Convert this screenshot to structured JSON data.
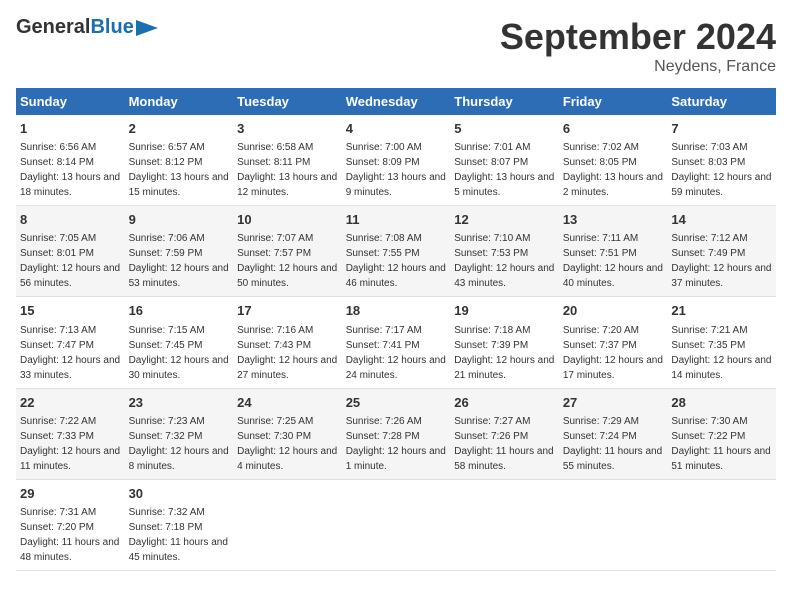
{
  "header": {
    "logo_general": "General",
    "logo_blue": "Blue",
    "month": "September 2024",
    "location": "Neydens, France"
  },
  "weekdays": [
    "Sunday",
    "Monday",
    "Tuesday",
    "Wednesday",
    "Thursday",
    "Friday",
    "Saturday"
  ],
  "weeks": [
    [
      {
        "day": "1",
        "sunrise": "6:56 AM",
        "sunset": "8:14 PM",
        "daylight": "13 hours and 18 minutes."
      },
      {
        "day": "2",
        "sunrise": "6:57 AM",
        "sunset": "8:12 PM",
        "daylight": "13 hours and 15 minutes."
      },
      {
        "day": "3",
        "sunrise": "6:58 AM",
        "sunset": "8:11 PM",
        "daylight": "13 hours and 12 minutes."
      },
      {
        "day": "4",
        "sunrise": "7:00 AM",
        "sunset": "8:09 PM",
        "daylight": "13 hours and 9 minutes."
      },
      {
        "day": "5",
        "sunrise": "7:01 AM",
        "sunset": "8:07 PM",
        "daylight": "13 hours and 5 minutes."
      },
      {
        "day": "6",
        "sunrise": "7:02 AM",
        "sunset": "8:05 PM",
        "daylight": "13 hours and 2 minutes."
      },
      {
        "day": "7",
        "sunrise": "7:03 AM",
        "sunset": "8:03 PM",
        "daylight": "12 hours and 59 minutes."
      }
    ],
    [
      {
        "day": "8",
        "sunrise": "7:05 AM",
        "sunset": "8:01 PM",
        "daylight": "12 hours and 56 minutes."
      },
      {
        "day": "9",
        "sunrise": "7:06 AM",
        "sunset": "7:59 PM",
        "daylight": "12 hours and 53 minutes."
      },
      {
        "day": "10",
        "sunrise": "7:07 AM",
        "sunset": "7:57 PM",
        "daylight": "12 hours and 50 minutes."
      },
      {
        "day": "11",
        "sunrise": "7:08 AM",
        "sunset": "7:55 PM",
        "daylight": "12 hours and 46 minutes."
      },
      {
        "day": "12",
        "sunrise": "7:10 AM",
        "sunset": "7:53 PM",
        "daylight": "12 hours and 43 minutes."
      },
      {
        "day": "13",
        "sunrise": "7:11 AM",
        "sunset": "7:51 PM",
        "daylight": "12 hours and 40 minutes."
      },
      {
        "day": "14",
        "sunrise": "7:12 AM",
        "sunset": "7:49 PM",
        "daylight": "12 hours and 37 minutes."
      }
    ],
    [
      {
        "day": "15",
        "sunrise": "7:13 AM",
        "sunset": "7:47 PM",
        "daylight": "12 hours and 33 minutes."
      },
      {
        "day": "16",
        "sunrise": "7:15 AM",
        "sunset": "7:45 PM",
        "daylight": "12 hours and 30 minutes."
      },
      {
        "day": "17",
        "sunrise": "7:16 AM",
        "sunset": "7:43 PM",
        "daylight": "12 hours and 27 minutes."
      },
      {
        "day": "18",
        "sunrise": "7:17 AM",
        "sunset": "7:41 PM",
        "daylight": "12 hours and 24 minutes."
      },
      {
        "day": "19",
        "sunrise": "7:18 AM",
        "sunset": "7:39 PM",
        "daylight": "12 hours and 21 minutes."
      },
      {
        "day": "20",
        "sunrise": "7:20 AM",
        "sunset": "7:37 PM",
        "daylight": "12 hours and 17 minutes."
      },
      {
        "day": "21",
        "sunrise": "7:21 AM",
        "sunset": "7:35 PM",
        "daylight": "12 hours and 14 minutes."
      }
    ],
    [
      {
        "day": "22",
        "sunrise": "7:22 AM",
        "sunset": "7:33 PM",
        "daylight": "12 hours and 11 minutes."
      },
      {
        "day": "23",
        "sunrise": "7:23 AM",
        "sunset": "7:32 PM",
        "daylight": "12 hours and 8 minutes."
      },
      {
        "day": "24",
        "sunrise": "7:25 AM",
        "sunset": "7:30 PM",
        "daylight": "12 hours and 4 minutes."
      },
      {
        "day": "25",
        "sunrise": "7:26 AM",
        "sunset": "7:28 PM",
        "daylight": "12 hours and 1 minute."
      },
      {
        "day": "26",
        "sunrise": "7:27 AM",
        "sunset": "7:26 PM",
        "daylight": "11 hours and 58 minutes."
      },
      {
        "day": "27",
        "sunrise": "7:29 AM",
        "sunset": "7:24 PM",
        "daylight": "11 hours and 55 minutes."
      },
      {
        "day": "28",
        "sunrise": "7:30 AM",
        "sunset": "7:22 PM",
        "daylight": "11 hours and 51 minutes."
      }
    ],
    [
      {
        "day": "29",
        "sunrise": "7:31 AM",
        "sunset": "7:20 PM",
        "daylight": "11 hours and 48 minutes."
      },
      {
        "day": "30",
        "sunrise": "7:32 AM",
        "sunset": "7:18 PM",
        "daylight": "11 hours and 45 minutes."
      },
      {
        "day": "",
        "sunrise": "",
        "sunset": "",
        "daylight": ""
      },
      {
        "day": "",
        "sunrise": "",
        "sunset": "",
        "daylight": ""
      },
      {
        "day": "",
        "sunrise": "",
        "sunset": "",
        "daylight": ""
      },
      {
        "day": "",
        "sunrise": "",
        "sunset": "",
        "daylight": ""
      },
      {
        "day": "",
        "sunrise": "",
        "sunset": "",
        "daylight": ""
      }
    ]
  ]
}
